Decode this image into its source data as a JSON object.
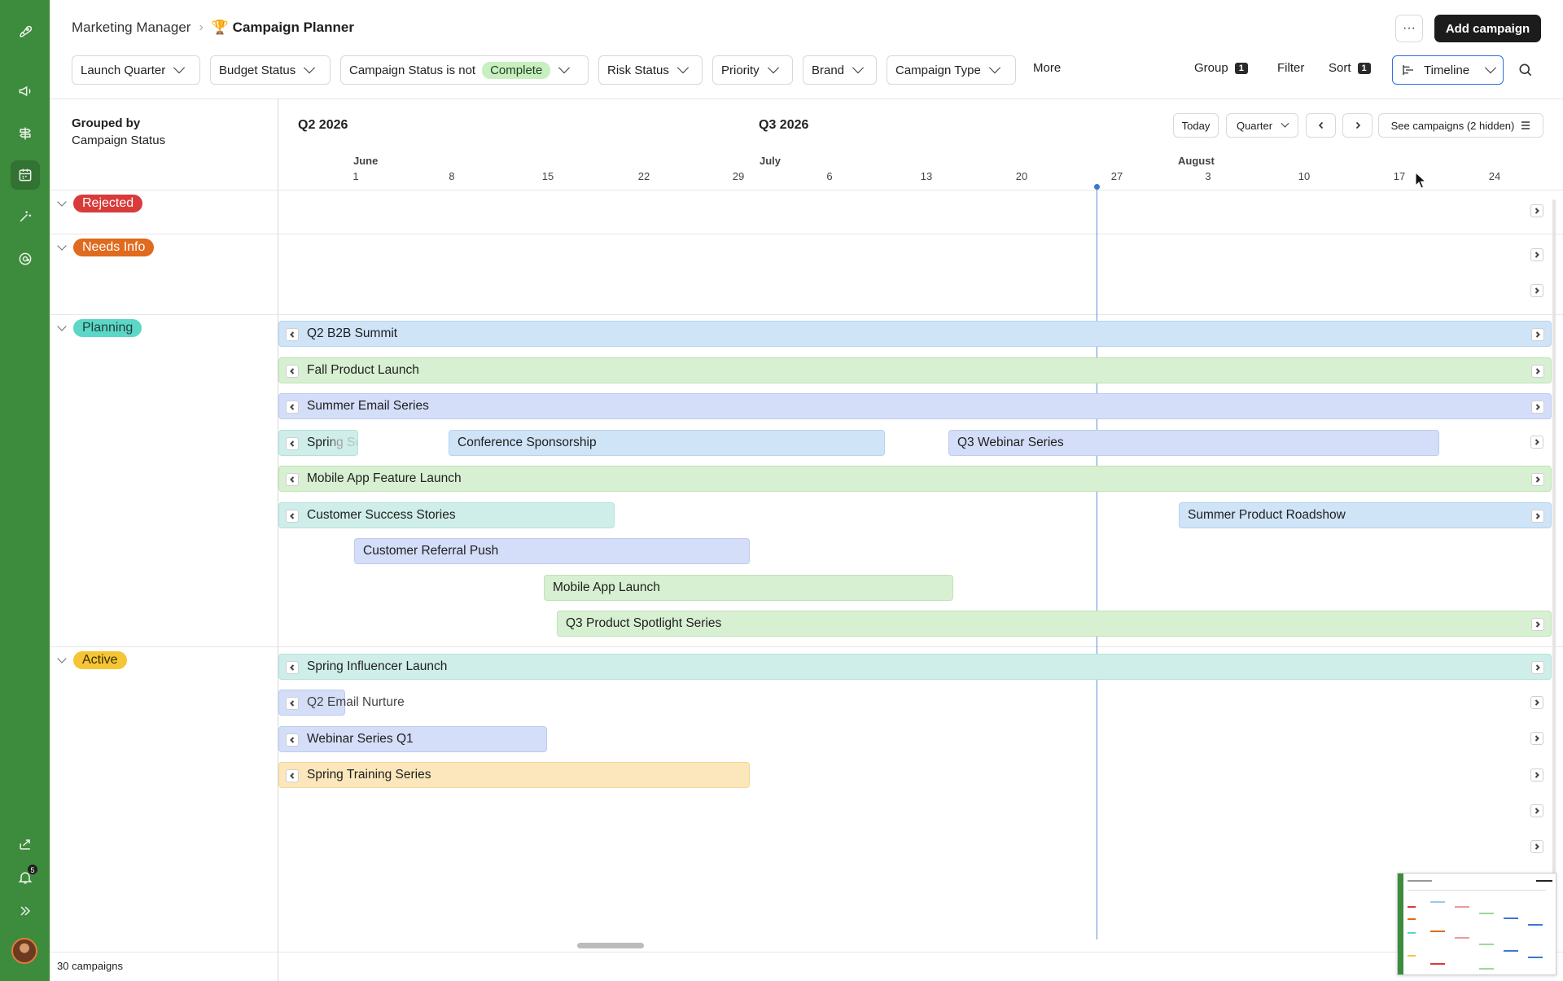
{
  "breadcrumb": {
    "parent": "Marketing Manager",
    "current": "🏆 Campaign Planner"
  },
  "header": {
    "more_label": "···",
    "add_label": "Add campaign"
  },
  "filters": [
    {
      "label": "Launch Quarter"
    },
    {
      "label": "Budget Status"
    },
    {
      "label": "Campaign Status is not",
      "value": "Complete"
    },
    {
      "label": "Risk Status"
    },
    {
      "label": "Priority"
    },
    {
      "label": "Brand"
    },
    {
      "label": "Campaign Type"
    }
  ],
  "toolbar": {
    "more": "More",
    "group_label": "Group",
    "group_count": "1",
    "filter_label": "Filter",
    "sort_label": "Sort",
    "sort_count": "1",
    "view_label": "Timeline"
  },
  "sidebar": {
    "grouped_by_key": "Grouped by",
    "grouped_by_value": "Campaign Status",
    "footer": "30 campaigns",
    "notification_count": "5",
    "icons": [
      "rocket-icon",
      "megaphone-icon",
      "signpost-icon",
      "calendar-icon",
      "magic-wand-icon",
      "at-sign-icon",
      "share-icon",
      "bell-icon",
      "expand-icon"
    ]
  },
  "groups": [
    {
      "label": "Rejected",
      "color": "#d93a3a",
      "text_color": "#ffffff"
    },
    {
      "label": "Needs Info",
      "color": "#e06a1e",
      "text_color": "#ffffff"
    },
    {
      "label": "Planning",
      "color": "#5cd6c7",
      "text_color": "#1f3d38"
    },
    {
      "label": "Active",
      "color": "#f5c535",
      "text_color": "#3b2e00"
    }
  ],
  "timeline": {
    "quarter_left": "Q2 2026",
    "quarter_right": "Q3 2026",
    "today": "Today",
    "scale": "Quarter",
    "see_campaigns": "See campaigns (2 hidden)",
    "months": [
      "June",
      "July",
      "August"
    ],
    "ticks": [
      "1",
      "8",
      "15",
      "22",
      "29",
      "6",
      "13",
      "20",
      "27",
      "3",
      "10",
      "17",
      "24"
    ]
  },
  "bars": [
    {
      "name": "Q2 B2B Summit",
      "color": "blue"
    },
    {
      "name": "Fall Product Launch",
      "color": "green"
    },
    {
      "name": "Summer Email Series",
      "color": "lavender"
    },
    {
      "name": "Spring Social Media Bl",
      "color": "teal"
    },
    {
      "name": "Conference Sponsorship",
      "color": "blue"
    },
    {
      "name": "Q3 Webinar Series",
      "color": "lavender"
    },
    {
      "name": "Mobile App Feature Launch",
      "color": "green"
    },
    {
      "name": "Customer Success Stories",
      "color": "teal"
    },
    {
      "name": "Summer Product Roadshow",
      "color": "blue"
    },
    {
      "name": "Customer Referral Push",
      "color": "lavender"
    },
    {
      "name": "Mobile App Launch",
      "color": "green"
    },
    {
      "name": "Q3 Product Spotlight Series",
      "color": "green"
    },
    {
      "name": "Spring Influencer Launch",
      "color": "teal"
    },
    {
      "name": "Q2 Email Nurture",
      "color": "lavender"
    },
    {
      "name": "Webinar Series Q1",
      "color": "lavender"
    },
    {
      "name": "Spring Training Series",
      "color": "yellow"
    }
  ]
}
